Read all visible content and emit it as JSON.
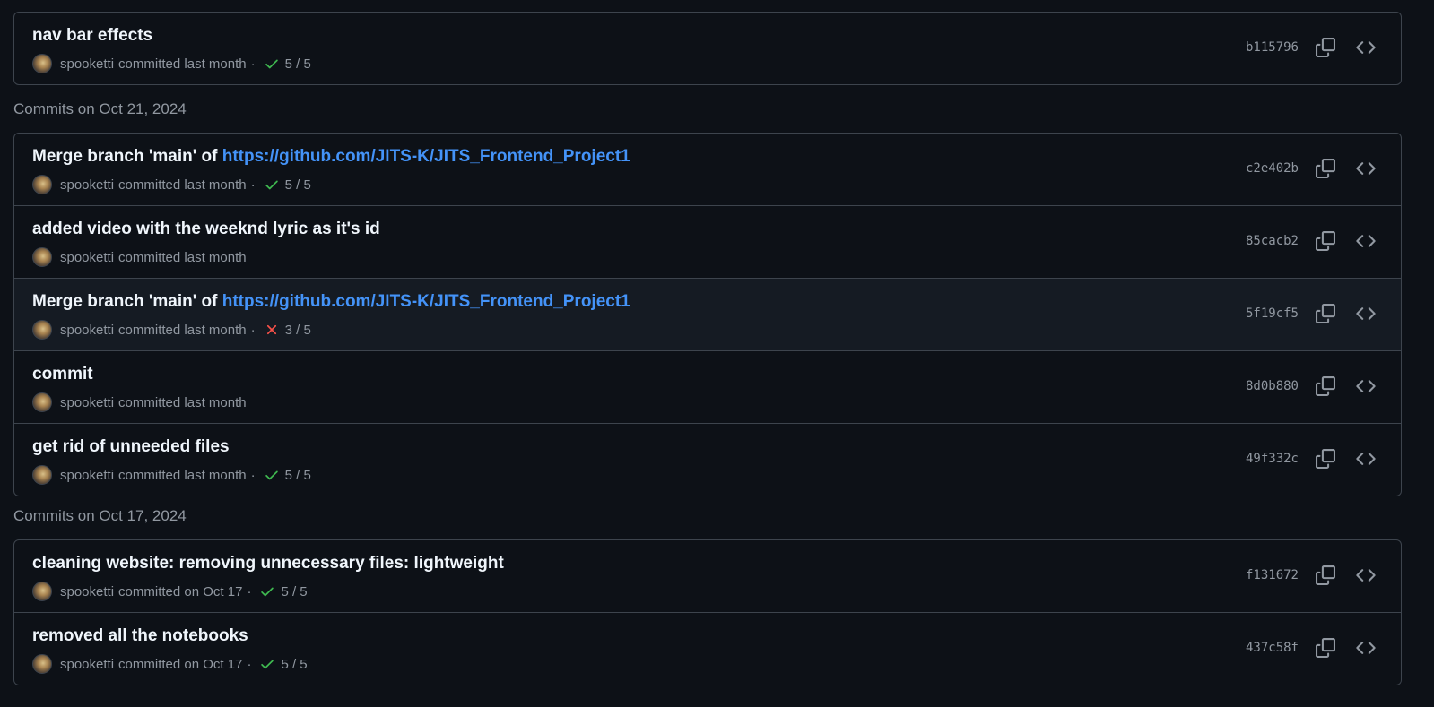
{
  "groups": [
    {
      "header": "",
      "commits": [
        {
          "title": "nav bar effects",
          "link": "",
          "author": "spooketti",
          "time": "committed last month",
          "status": "pass",
          "checks": "5 / 5",
          "sha": "b115796"
        }
      ]
    },
    {
      "header": "Commits on Oct 21, 2024",
      "commits": [
        {
          "title": "Merge branch 'main' of ",
          "link": "https://github.com/JITS-K/JITS_Frontend_Project1",
          "author": "spooketti",
          "time": "committed last month",
          "status": "pass",
          "checks": "5 / 5",
          "sha": "c2e402b"
        },
        {
          "title": "added video with the weeknd lyric as it's id",
          "link": "",
          "author": "spooketti",
          "time": "committed last month",
          "status": "none",
          "checks": "",
          "sha": "85cacb2"
        },
        {
          "title": "Merge branch 'main' of ",
          "link": "https://github.com/JITS-K/JITS_Frontend_Project1",
          "author": "spooketti",
          "time": "committed last month",
          "status": "fail",
          "checks": "3 / 5",
          "sha": "5f19cf5"
        },
        {
          "title": "commit",
          "link": "",
          "author": "spooketti",
          "time": "committed last month",
          "status": "none",
          "checks": "",
          "sha": "8d0b880"
        },
        {
          "title": "get rid of unneeded files",
          "link": "",
          "author": "spooketti",
          "time": "committed last month",
          "status": "pass",
          "checks": "5 / 5",
          "sha": "49f332c"
        }
      ]
    },
    {
      "header": "Commits on Oct 17, 2024",
      "commits": [
        {
          "title": "cleaning website: removing unnecessary files: lightweight",
          "link": "",
          "author": "spooketti",
          "time": "committed on Oct 17",
          "status": "pass",
          "checks": "5 / 5",
          "sha": "f131672"
        },
        {
          "title": "removed all the notebooks",
          "link": "",
          "author": "spooketti",
          "time": "committed on Oct 17",
          "status": "pass",
          "checks": "5 / 5",
          "sha": "437c58f"
        }
      ]
    }
  ],
  "meta_separator": "·",
  "colors": {
    "background": "#0d1117",
    "border": "#3d444d",
    "link": "#4493f8",
    "success": "#3fb950",
    "failure": "#f85149",
    "muted": "#9198a1"
  },
  "icons": {
    "copy": "copy-icon",
    "browse": "code-icon",
    "pass": "check-icon",
    "fail": "x-icon"
  }
}
